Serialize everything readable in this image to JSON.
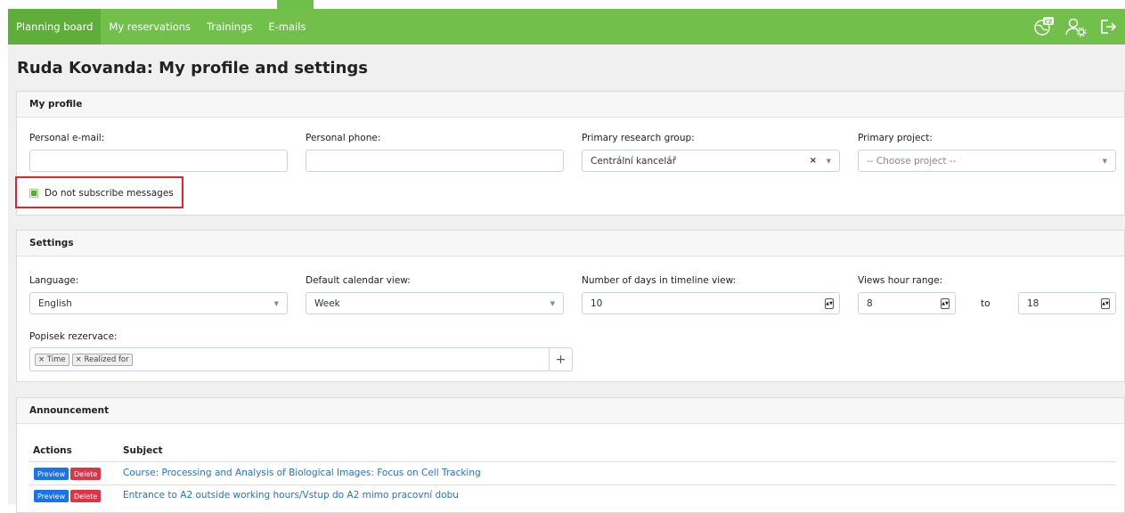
{
  "nav": {
    "items": [
      {
        "label": "Planning board",
        "active": true
      },
      {
        "label": "My reservations",
        "active": false
      },
      {
        "label": "Trainings",
        "active": false
      },
      {
        "label": "E-mails",
        "active": false
      }
    ],
    "language_badge": "CZ",
    "icons": [
      "language-globe-icon",
      "user-settings-icon",
      "logout-icon"
    ]
  },
  "page": {
    "title": "Ruda Kovanda: My profile and settings"
  },
  "profile": {
    "header": "My profile",
    "email_label": "Personal e-mail:",
    "email_value": "",
    "phone_label": "Personal phone:",
    "phone_value": "",
    "group_label": "Primary research group:",
    "group_value": "Centrální kancelář",
    "project_label": "Primary project:",
    "project_placeholder": "-- Choose project --",
    "unsubscribe_label": "Do not subscribe messages",
    "unsubscribe_checked": true
  },
  "settings": {
    "header": "Settings",
    "language_label": "Language:",
    "language_value": "English",
    "calendar_label": "Default calendar view:",
    "calendar_value": "Week",
    "days_label": "Number of days in timeline view:",
    "days_value": "10",
    "hours_label": "Views hour range:",
    "hours_from": "8",
    "hours_to_label": "to",
    "hours_to": "18",
    "popisek_label": "Popisek rezervace:",
    "tags": [
      "Time",
      "Realized for"
    ],
    "add_symbol": "+"
  },
  "announcement": {
    "header": "Announcement",
    "col_actions": "Actions",
    "col_subject": "Subject",
    "preview_label": "Preview",
    "delete_label": "Delete",
    "rows": [
      {
        "subject": "Course: Processing and Analysis of Biological Images: Focus on Cell Tracking"
      },
      {
        "subject": "Entrance to A2 outside working hours/Vstup do A2 mimo pracovní dobu"
      }
    ]
  },
  "colors": {
    "navbar": "#72c04b",
    "highlight": "#e0262c",
    "link": "#2474c9"
  }
}
